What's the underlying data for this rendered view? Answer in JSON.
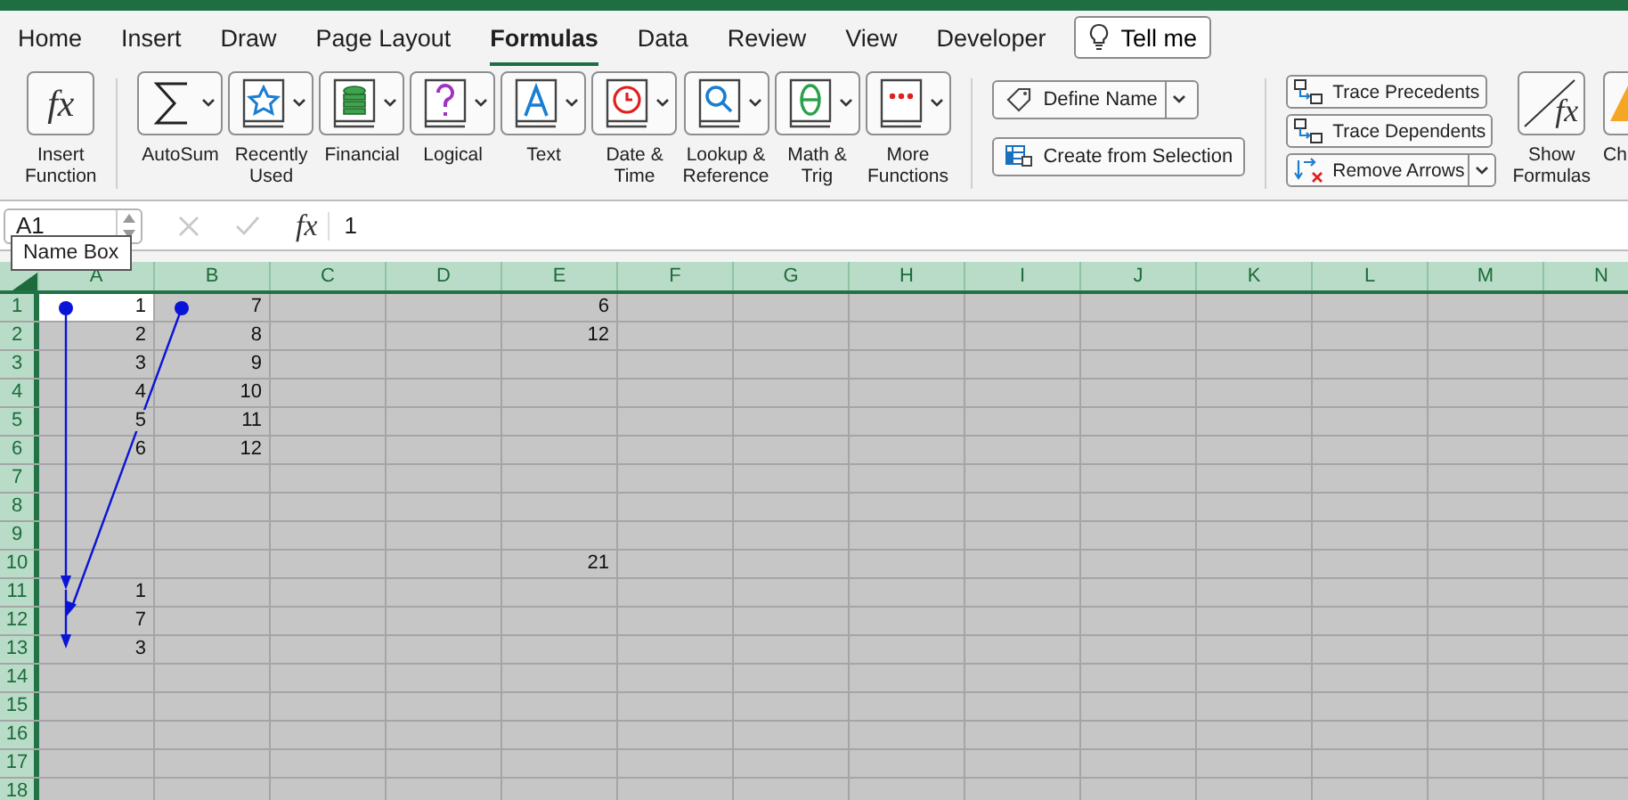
{
  "tabs": [
    {
      "label": "Home",
      "selected": false
    },
    {
      "label": "Insert",
      "selected": false
    },
    {
      "label": "Draw",
      "selected": false
    },
    {
      "label": "Page Layout",
      "selected": false
    },
    {
      "label": "Formulas",
      "selected": true
    },
    {
      "label": "Data",
      "selected": false
    },
    {
      "label": "Review",
      "selected": false
    },
    {
      "label": "View",
      "selected": false
    },
    {
      "label": "Developer",
      "selected": false
    }
  ],
  "tell_me": {
    "label": "Tell me"
  },
  "ribbon": {
    "insert_function": {
      "icon_text": "fx",
      "label": "Insert\nFunction"
    },
    "function_library": [
      {
        "label": "AutoSum"
      },
      {
        "label": "Recently\nUsed"
      },
      {
        "label": "Financial"
      },
      {
        "label": "Logical"
      },
      {
        "label": "Text"
      },
      {
        "label": "Date &\nTime"
      },
      {
        "label": "Lookup &\nReference"
      },
      {
        "label": "Math &\nTrig"
      },
      {
        "label": "More\nFunctions"
      }
    ],
    "defined_names": [
      {
        "label": "Define Name",
        "dropdown": true
      },
      {
        "label": "Create from Selection",
        "dropdown": false
      }
    ],
    "formula_auditing": [
      {
        "label": "Trace Precedents",
        "dropdown": false
      },
      {
        "label": "Trace Dependents",
        "dropdown": false
      },
      {
        "label": "Remove Arrows",
        "dropdown": true
      }
    ],
    "show_formulas": {
      "icon_text": "fx",
      "label": "Show\nFormulas"
    },
    "cut_off_button": {
      "label": "Ch"
    }
  },
  "formula_bar": {
    "name_box": "A1",
    "tooltip": "Name Box",
    "function_button": "fx",
    "value": "1"
  },
  "sheet": {
    "all_selected": true,
    "trace_arrows_shown": true,
    "columns": [
      "A",
      "B",
      "C",
      "D",
      "E",
      "F",
      "G",
      "H",
      "I",
      "J",
      "K",
      "L",
      "M",
      "N"
    ],
    "rows": [
      {
        "header": "1",
        "cells": {
          "A": "1",
          "B": "7",
          "E": "6"
        }
      },
      {
        "header": "2",
        "cells": {
          "A": "2",
          "B": "8",
          "E": "12"
        }
      },
      {
        "header": "3",
        "cells": {
          "A": "3",
          "B": "9"
        }
      },
      {
        "header": "4",
        "cells": {
          "A": "4",
          "B": "10"
        }
      },
      {
        "header": "5",
        "cells": {
          "A": "5",
          "B": "11"
        }
      },
      {
        "header": "6",
        "cells": {
          "A": "6",
          "B": "12"
        }
      },
      {
        "header": "7",
        "cells": {}
      },
      {
        "header": "8",
        "cells": {}
      },
      {
        "header": "9",
        "cells": {}
      },
      {
        "header": "10",
        "cells": {
          "E": "21"
        }
      },
      {
        "header": "11",
        "cells": {
          "A": "1"
        }
      },
      {
        "header": "12",
        "cells": {
          "A": "7"
        }
      },
      {
        "header": "13",
        "cells": {
          "A": "3"
        }
      },
      {
        "header": "14",
        "cells": {}
      },
      {
        "header": "15",
        "cells": {}
      },
      {
        "header": "16",
        "cells": {}
      },
      {
        "header": "17",
        "cells": {}
      },
      {
        "header": "18",
        "cells": {}
      }
    ]
  }
}
